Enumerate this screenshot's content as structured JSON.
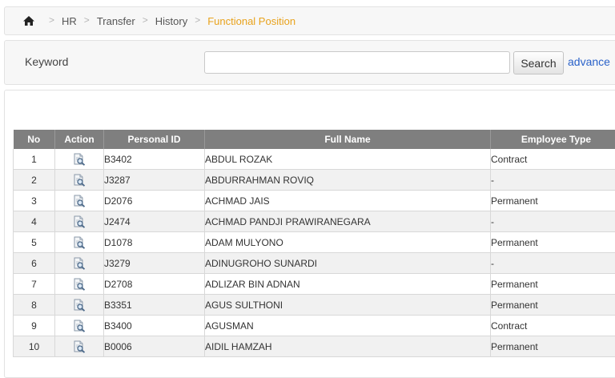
{
  "breadcrumb": {
    "home_icon": "home-icon",
    "items": [
      "HR",
      "Transfer",
      "History"
    ],
    "current": "Functional Position"
  },
  "search": {
    "label": "Keyword",
    "value": "",
    "placeholder": "",
    "button_label": "Search",
    "advance_label": "advance"
  },
  "table": {
    "headers": [
      "No",
      "Action",
      "Personal ID",
      "Full Name",
      "Employee Type"
    ],
    "rows": [
      {
        "no": "1",
        "id": "B3402",
        "name": "ABDUL ROZAK",
        "type": "Contract"
      },
      {
        "no": "2",
        "id": "J3287",
        "name": "ABDURRAHMAN ROVIQ",
        "type": "-"
      },
      {
        "no": "3",
        "id": "D2076",
        "name": "ACHMAD JAIS",
        "type": "Permanent"
      },
      {
        "no": "4",
        "id": "J2474",
        "name": "ACHMAD PANDJI PRAWIRANEGARA",
        "type": "-"
      },
      {
        "no": "5",
        "id": "D1078",
        "name": "ADAM MULYONO",
        "type": "Permanent"
      },
      {
        "no": "6",
        "id": "J3279",
        "name": "ADINUGROHO SUNARDI",
        "type": "-"
      },
      {
        "no": "7",
        "id": "D2708",
        "name": "ADLIZAR BIN ADNAN",
        "type": "Permanent"
      },
      {
        "no": "8",
        "id": "B3351",
        "name": "AGUS SULTHONI",
        "type": "Permanent"
      },
      {
        "no": "9",
        "id": "B3400",
        "name": "AGUSMAN",
        "type": "Contract"
      },
      {
        "no": "10",
        "id": "B0006",
        "name": "AIDIL HAMZAH",
        "type": "Permanent"
      }
    ],
    "action_icon": "view-detail-icon"
  },
  "colors": {
    "header_bg": "#7f7f7f",
    "active_crumb": "#e8a21c",
    "link": "#2a62c9"
  }
}
